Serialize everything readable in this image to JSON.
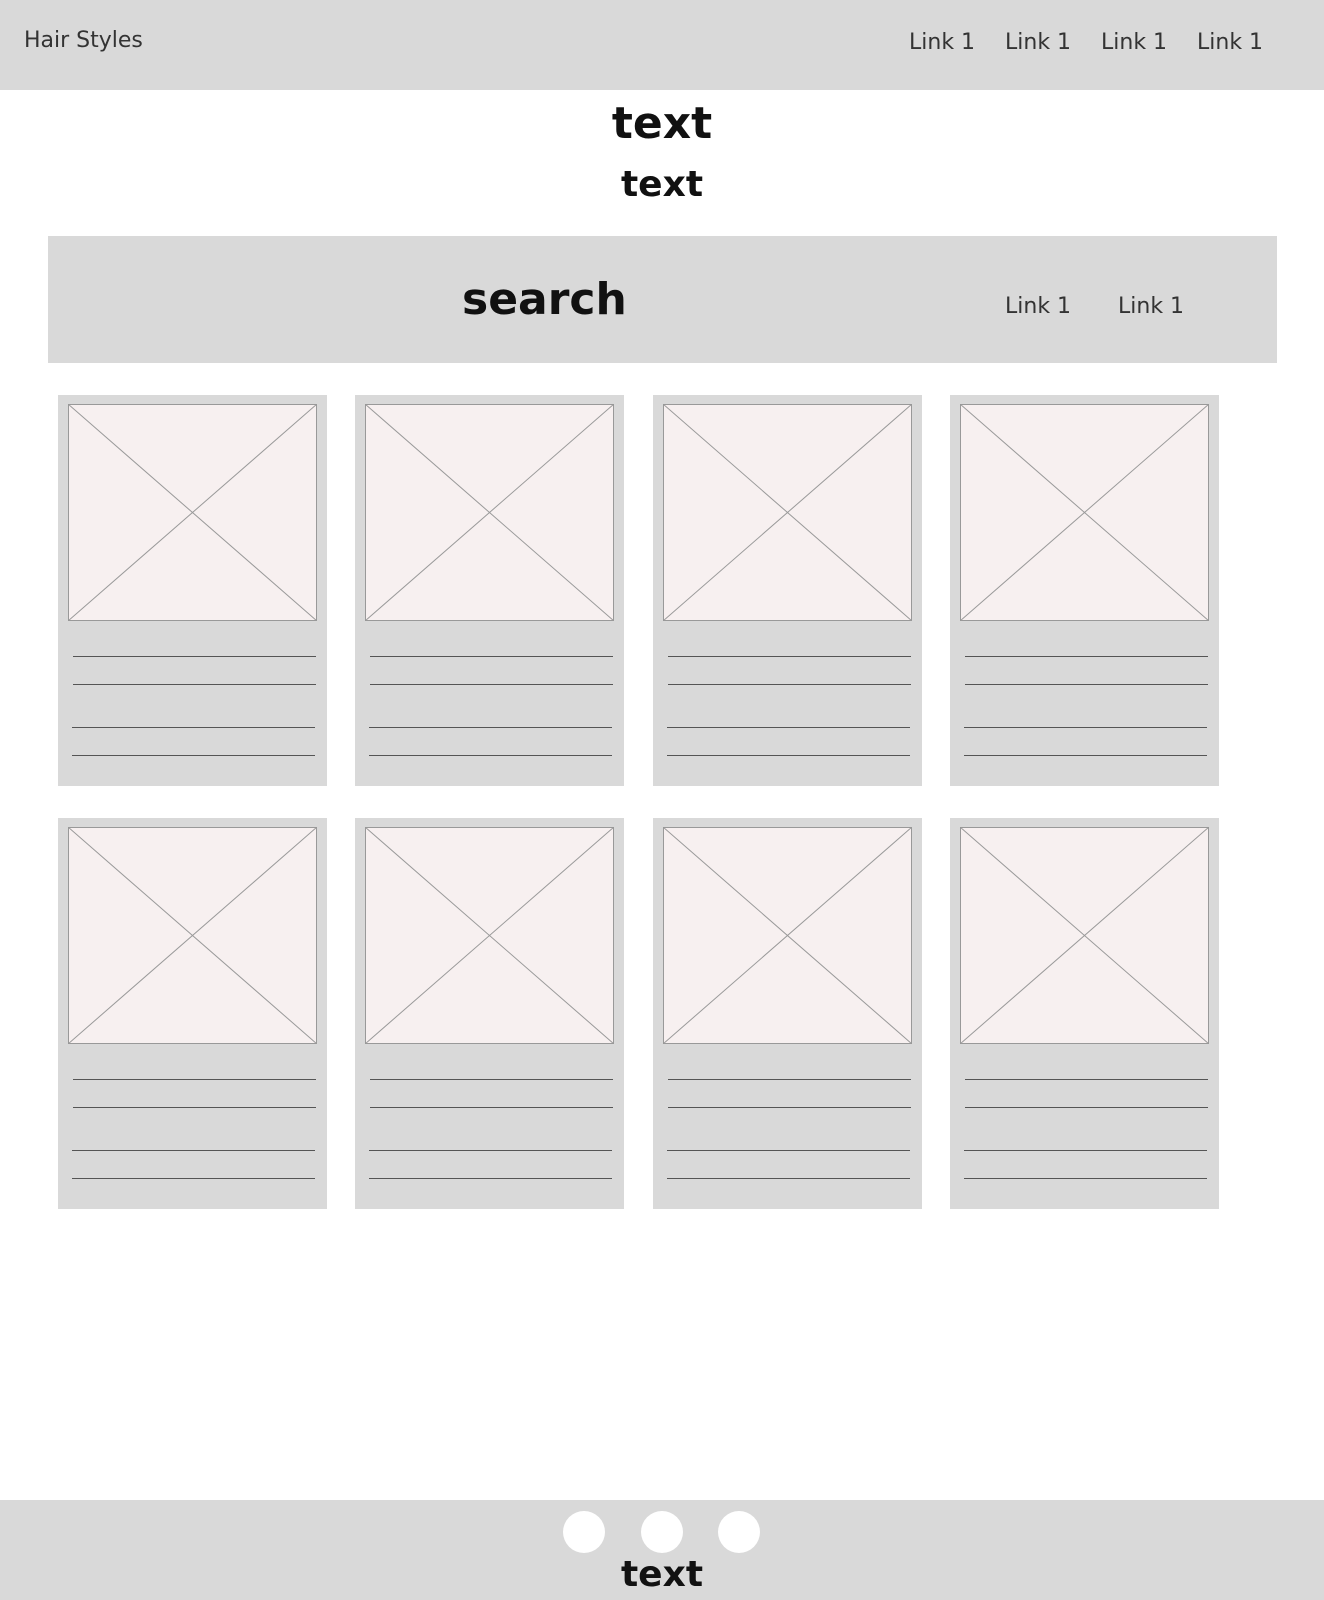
{
  "header": {
    "brand": "Hair Styles",
    "nav_links": [
      "Link 1",
      "Link 1",
      "Link 1",
      "Link 1"
    ]
  },
  "hero": {
    "title": "text",
    "subtitle": "text"
  },
  "search_bar": {
    "label": "search",
    "links": [
      "Link 1",
      "Link 1"
    ]
  },
  "gallery": {
    "card_count": 8,
    "image_placeholder": "image-placeholder-icon",
    "colors": {
      "card_bg": "#d9d9d9",
      "image_fill": "#f7f0f0",
      "image_cross": "#999999"
    }
  },
  "footer": {
    "social_icons": [
      "circle-icon",
      "circle-icon",
      "circle-icon"
    ],
    "text": "text"
  },
  "colors": {
    "panel_gray": "#d9d9d9",
    "page_bg": "#ffffff"
  }
}
